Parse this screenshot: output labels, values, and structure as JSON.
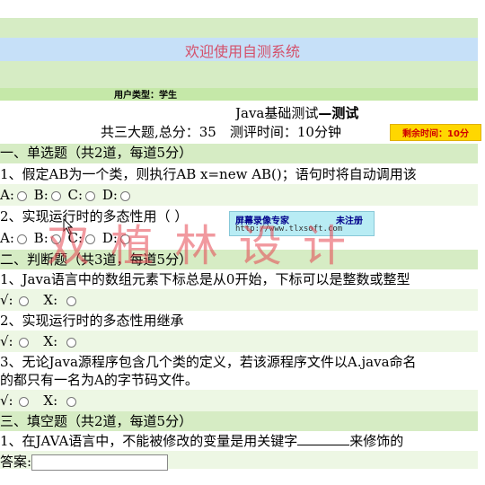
{
  "banner": {
    "title": "欢迎使用自测系统"
  },
  "user": {
    "type_label": "用户类型：学生"
  },
  "exam": {
    "title_normal": "Java基础测试",
    "title_bold": "—测试",
    "summary": "共三大题,总分：35　测评时间：10分钟",
    "timer": "剩余时间：10分"
  },
  "sections": {
    "s1": {
      "heading": "一、单选题（共2道，每道5分）",
      "q1": "1、假定AB为一个类，则执行AB x=new AB()；语句时将自动调用该",
      "q2": "2、实现运行时的多态性用（ ）",
      "options": [
        "A:",
        "B:",
        "C:",
        "D:"
      ]
    },
    "s2": {
      "heading": "二、判断题（共3道，每道5分）",
      "q1": "1、Java语言中的数组元素下标总是从0开始，下标可以是整数或整型",
      "q2": "2、实现运行时的多态性用继承",
      "q3_line1": "3、无论Java源程序包含几个类的定义，若该源程序文件以A.java命名",
      "q3_line2": "的都只有一名为A的字节码文件。",
      "true_label": "√:",
      "false_label": "X:"
    },
    "s3": {
      "heading": "三、填空题（共2道，每道5分）",
      "q1_before": "1、在JAVA语言中，不能被修改的变量是用关键字",
      "q1_after": "来修饰的",
      "answer_label": "答案:"
    }
  },
  "overlay": {
    "ad_title": "屏幕录像专家",
    "ad_status": "未注册",
    "ad_url": "http://www.tlxsoft.com",
    "watermark": "双 植 林 设 计"
  },
  "colors": {
    "stripe_green": "#d6ecc4",
    "stripe_light": "#edf7e4",
    "banner_blue": "#c6e0f8",
    "banner_text": "#d4506a",
    "timer_bg": "#ffd700",
    "timer_text": "#d00000"
  }
}
